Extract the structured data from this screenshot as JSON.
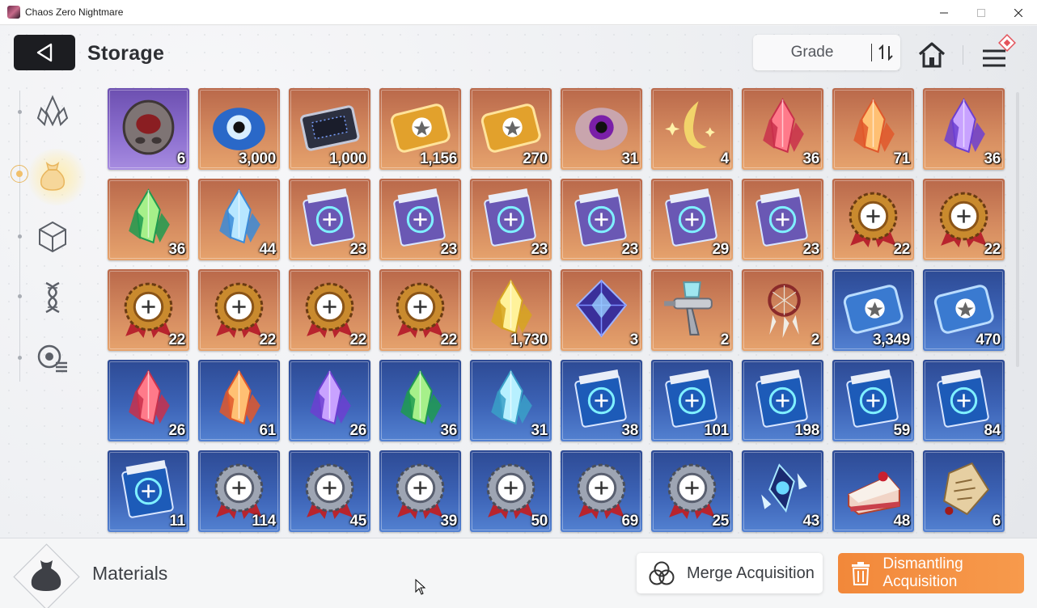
{
  "window": {
    "title": "Chaos Zero Nightmare"
  },
  "header": {
    "title": "Storage",
    "sort_label": "Grade"
  },
  "rail": {
    "items": [
      {
        "icon": "crystal-cluster-icon",
        "active": false
      },
      {
        "icon": "pouch-icon",
        "active": true
      },
      {
        "icon": "cube-icon",
        "active": false
      },
      {
        "icon": "dna-icon",
        "active": false
      },
      {
        "icon": "badge-list-icon",
        "active": false
      }
    ]
  },
  "items": [
    {
      "count": "6",
      "rarity": "purple",
      "icon": "dark-mask-icon"
    },
    {
      "count": "3,000",
      "rarity": "orange",
      "icon": "eye-orb-icon"
    },
    {
      "count": "1,000",
      "rarity": "orange",
      "icon": "chip-card-icon"
    },
    {
      "count": "1,156",
      "rarity": "orange",
      "icon": "gold-ticket-icon"
    },
    {
      "count": "270",
      "rarity": "orange",
      "icon": "star-ticket-icon"
    },
    {
      "count": "31",
      "rarity": "orange",
      "icon": "purple-eye-icon"
    },
    {
      "count": "4",
      "rarity": "orange",
      "icon": "moon-feather-icon"
    },
    {
      "count": "36",
      "rarity": "orange",
      "icon": "red-crystal-icon"
    },
    {
      "count": "71",
      "rarity": "orange",
      "icon": "orange-crystal-icon"
    },
    {
      "count": "36",
      "rarity": "orange",
      "icon": "purple-crystal-icon"
    },
    {
      "count": "36",
      "rarity": "orange",
      "icon": "green-crystal-icon"
    },
    {
      "count": "44",
      "rarity": "orange",
      "icon": "blue-crystal-icon"
    },
    {
      "count": "23",
      "rarity": "orange",
      "icon": "sword-tome-icon"
    },
    {
      "count": "23",
      "rarity": "orange",
      "icon": "shield-tome-icon"
    },
    {
      "count": "23",
      "rarity": "orange",
      "icon": "eye-tome-icon"
    },
    {
      "count": "23",
      "rarity": "orange",
      "icon": "ranger-tome-icon"
    },
    {
      "count": "29",
      "rarity": "orange",
      "icon": "bolt-tome-icon"
    },
    {
      "count": "23",
      "rarity": "orange",
      "icon": "target-tome-icon"
    },
    {
      "count": "22",
      "rarity": "orange",
      "icon": "gold-sword-medal-icon"
    },
    {
      "count": "22",
      "rarity": "orange",
      "icon": "gold-shield-medal-icon"
    },
    {
      "count": "22",
      "rarity": "orange",
      "icon": "gold-eye-medal-icon"
    },
    {
      "count": "22",
      "rarity": "orange",
      "icon": "gold-ranger-medal-icon"
    },
    {
      "count": "22",
      "rarity": "orange",
      "icon": "gold-bolt-medal-icon"
    },
    {
      "count": "22",
      "rarity": "orange",
      "icon": "gold-target-medal-icon"
    },
    {
      "count": "1,730",
      "rarity": "orange",
      "icon": "yellow-shards-icon"
    },
    {
      "count": "3",
      "rarity": "orange",
      "icon": "blue-octahedron-icon"
    },
    {
      "count": "2",
      "rarity": "orange",
      "icon": "spray-gun-icon"
    },
    {
      "count": "2",
      "rarity": "orange",
      "icon": "dreamcatcher-icon"
    },
    {
      "count": "3,349",
      "rarity": "blue",
      "icon": "blue-ticket-icon"
    },
    {
      "count": "470",
      "rarity": "blue",
      "icon": "blue-star-ticket-icon"
    },
    {
      "count": "26",
      "rarity": "blue",
      "icon": "red-shard-icon"
    },
    {
      "count": "61",
      "rarity": "blue",
      "icon": "orange-shard-icon"
    },
    {
      "count": "26",
      "rarity": "blue",
      "icon": "purple-shard-icon"
    },
    {
      "count": "36",
      "rarity": "blue",
      "icon": "green-shard-icon"
    },
    {
      "count": "31",
      "rarity": "blue",
      "icon": "cyan-shard-icon"
    },
    {
      "count": "38",
      "rarity": "blue",
      "icon": "blue-sword-tome-icon"
    },
    {
      "count": "101",
      "rarity": "blue",
      "icon": "blue-shield-tome-icon"
    },
    {
      "count": "198",
      "rarity": "blue",
      "icon": "blue-eye-tome-icon"
    },
    {
      "count": "59",
      "rarity": "blue",
      "icon": "blue-ranger-tome-icon"
    },
    {
      "count": "84",
      "rarity": "blue",
      "icon": "blue-bolt-tome-icon"
    },
    {
      "count": "11",
      "rarity": "blue",
      "icon": "blue-target-tome-icon"
    },
    {
      "count": "114",
      "rarity": "blue",
      "icon": "silver-sword-medal-icon"
    },
    {
      "count": "45",
      "rarity": "blue",
      "icon": "silver-shield-medal-icon"
    },
    {
      "count": "39",
      "rarity": "blue",
      "icon": "silver-eye-medal-icon"
    },
    {
      "count": "50",
      "rarity": "blue",
      "icon": "silver-ranger-medal-icon"
    },
    {
      "count": "69",
      "rarity": "blue",
      "icon": "silver-bolt-medal-icon"
    },
    {
      "count": "25",
      "rarity": "blue",
      "icon": "silver-target-medal-icon"
    },
    {
      "count": "43",
      "rarity": "blue",
      "icon": "ice-gem-icon"
    },
    {
      "count": "48",
      "rarity": "blue",
      "icon": "cake-slice-icon"
    },
    {
      "count": "6",
      "rarity": "blue",
      "icon": "paper-charm-icon"
    }
  ],
  "footer": {
    "category_label": "Materials",
    "merge_label": "Merge Acquisition",
    "dismantle_label": "Dismantling Acquisition"
  },
  "colors": {
    "accent_orange": "#f48d3f",
    "active_glow": "#ffe7a8",
    "back_button": "#1c1d21"
  }
}
